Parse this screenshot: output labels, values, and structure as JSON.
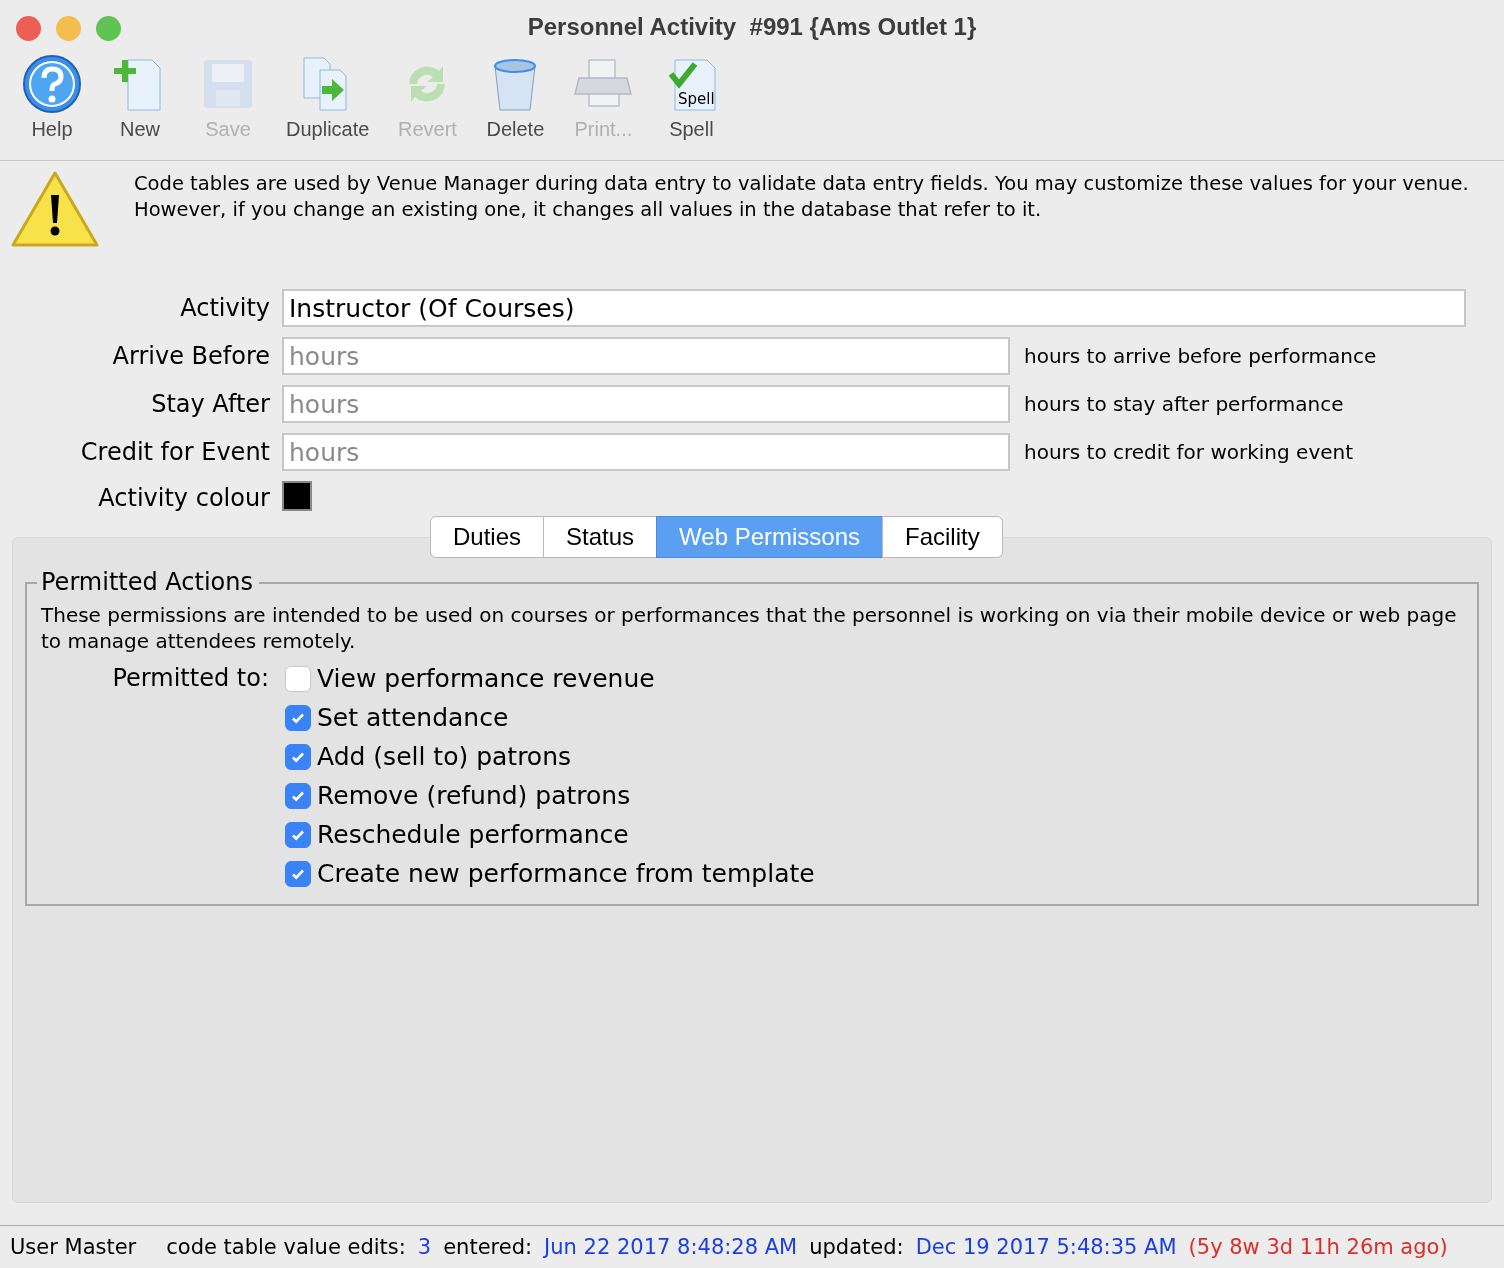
{
  "window": {
    "title": "Personnel Activity  #991 {Ams Outlet 1}"
  },
  "toolbar": [
    {
      "kind": "help",
      "label": "Help",
      "disabled": false
    },
    {
      "kind": "new",
      "label": "New",
      "disabled": false
    },
    {
      "kind": "save",
      "label": "Save",
      "disabled": true
    },
    {
      "kind": "duplicate",
      "label": "Duplicate",
      "disabled": false
    },
    {
      "kind": "revert",
      "label": "Revert",
      "disabled": true
    },
    {
      "kind": "delete",
      "label": "Delete",
      "disabled": false
    },
    {
      "kind": "print",
      "label": "Print...",
      "disabled": true
    },
    {
      "kind": "spell",
      "label": "Spell",
      "disabled": false,
      "icon_text": "Spell"
    }
  ],
  "notice": "Code tables are used by Venue Manager during data entry to validate data entry fields.  You may customize these values for your venue.  However, if you change an existing one, it changes all values in the database that refer to it.",
  "form": {
    "activity": {
      "label": "Activity",
      "value": "Instructor (Of Courses)"
    },
    "fields": [
      {
        "label": "Arrive Before",
        "placeholder": "hours",
        "hint": "hours to arrive before performance"
      },
      {
        "label": "Stay After",
        "placeholder": "hours",
        "hint": "hours to stay after performance"
      },
      {
        "label": "Credit for Event",
        "placeholder": "hours",
        "hint": "hours to credit for working event"
      }
    ],
    "colour": {
      "label": "Activity colour",
      "color": "#000000"
    }
  },
  "tabs": [
    {
      "label": "Duties",
      "selected": false
    },
    {
      "label": "Status",
      "selected": false
    },
    {
      "label": "Web Permissons",
      "selected": true
    },
    {
      "label": "Facility",
      "selected": false
    }
  ],
  "group": {
    "title": "Permitted Actions",
    "description": "These permissions are intended to be used on courses or performances that the personnel is working on via their mobile device or web page to manage attendees remotely.",
    "permitted_label": "Permitted to:",
    "options": [
      {
        "label": "View performance revenue",
        "checked": false
      },
      {
        "label": "Set attendance",
        "checked": true
      },
      {
        "label": "Add (sell to) patrons",
        "checked": true
      },
      {
        "label": "Remove (refund) patrons",
        "checked": true
      },
      {
        "label": "Reschedule performance",
        "checked": true
      },
      {
        "label": "Create new performance from template",
        "checked": true
      }
    ]
  },
  "status_bar": [
    {
      "kind": "user",
      "text": "User Master"
    },
    {
      "kind": "label",
      "text": "code table value edits:"
    },
    {
      "kind": "value",
      "text": "3"
    },
    {
      "kind": "label",
      "text": "entered:"
    },
    {
      "kind": "value",
      "text": "Jun 22 2017 8:48:28 AM"
    },
    {
      "kind": "label",
      "text": "updated:"
    },
    {
      "kind": "value",
      "text": "Dec 19 2017 5:48:35 AM"
    },
    {
      "kind": "age",
      "text": "(5y 8w 3d 11h 26m ago)"
    }
  ]
}
